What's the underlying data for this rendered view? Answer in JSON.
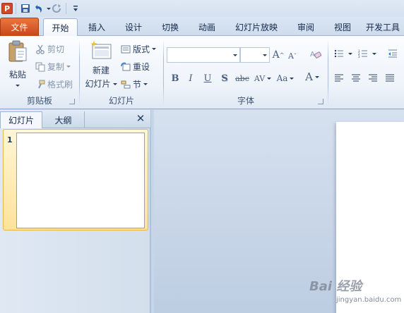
{
  "qat": {
    "app_icon": "P",
    "icons": [
      "powerpoint-icon",
      "save-icon",
      "undo-icon",
      "redo-icon",
      "customize-icon"
    ]
  },
  "tabs": {
    "file": "文件",
    "home": "开始",
    "insert": "插入",
    "design": "设计",
    "transitions": "切换",
    "animations": "动画",
    "slideshow": "幻灯片放映",
    "review": "审阅",
    "view": "视图",
    "developer": "开发工具"
  },
  "ribbon": {
    "clipboard": {
      "label": "剪贴板",
      "paste": "粘贴",
      "cut": "剪切",
      "copy": "复制",
      "format_painter": "格式刷"
    },
    "slides": {
      "label": "幻灯片",
      "new_slide_line1": "新建",
      "new_slide_line2": "幻灯片",
      "layout": "版式",
      "reset": "重设",
      "section": "节"
    },
    "font": {
      "label": "字体",
      "font_name": "",
      "font_size": "",
      "bold": "B",
      "italic": "I",
      "underline": "U",
      "shadow": "S",
      "strike": "abc",
      "spacing": "AV",
      "change_case": "Aa",
      "grow": "A",
      "shrink": "A",
      "color": "A"
    }
  },
  "left_pane": {
    "tab_slides": "幻灯片",
    "tab_outline": "大纲",
    "close": "✕",
    "slide_number": "1"
  },
  "watermark": {
    "brand": "Bai 经验",
    "url": "jingyan.baidu.com"
  },
  "colors": {
    "file_tab": "#d24726",
    "ribbon_bg": "#eef3fa",
    "selection": "#ffe29a",
    "workspace": "#cfdbe9"
  }
}
